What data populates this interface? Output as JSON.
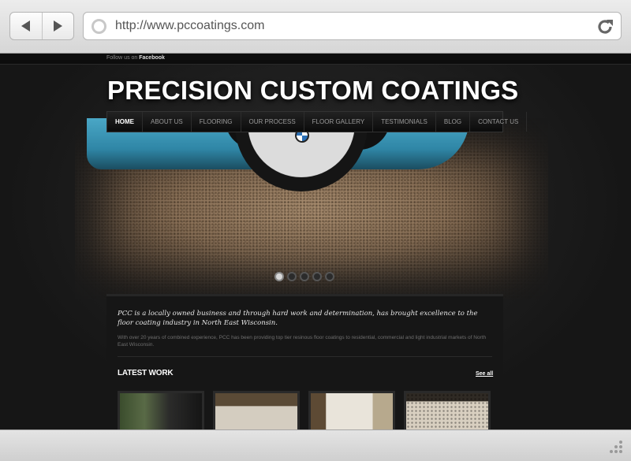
{
  "browser": {
    "url": "http://www.pccoatings.com"
  },
  "topbar": {
    "follow_prefix": "Follow us on",
    "follow_link": "Facebook"
  },
  "site": {
    "title": "PRECISION CUSTOM COATINGS"
  },
  "nav": {
    "items": [
      {
        "label": "HOME",
        "active": true
      },
      {
        "label": "ABOUT US",
        "active": false
      },
      {
        "label": "FLOORING",
        "active": false
      },
      {
        "label": "OUR PROCESS",
        "active": false
      },
      {
        "label": "FLOOR GALLERY",
        "active": false
      },
      {
        "label": "TESTIMONIALS",
        "active": false
      },
      {
        "label": "BLOG",
        "active": false
      },
      {
        "label": "CONTACT US",
        "active": false
      }
    ]
  },
  "slider": {
    "slide_count": 5,
    "active_index": 0
  },
  "intro": {
    "lead": "PCC is a locally owned business and through hard work and determination, has brought excellence to the floor coating industry in North East Wisconsin.",
    "sub": "With over 20 years of combined experience, PCC has been providing top tier resinous floor coatings to residential, commercial and light industrial markets of North East Wisconsin."
  },
  "latest_work": {
    "heading": "LATEST WORK",
    "see_all": "See all"
  },
  "colors": {
    "page_bg": "#1a1a1a",
    "accent_text": "#ffffff"
  }
}
